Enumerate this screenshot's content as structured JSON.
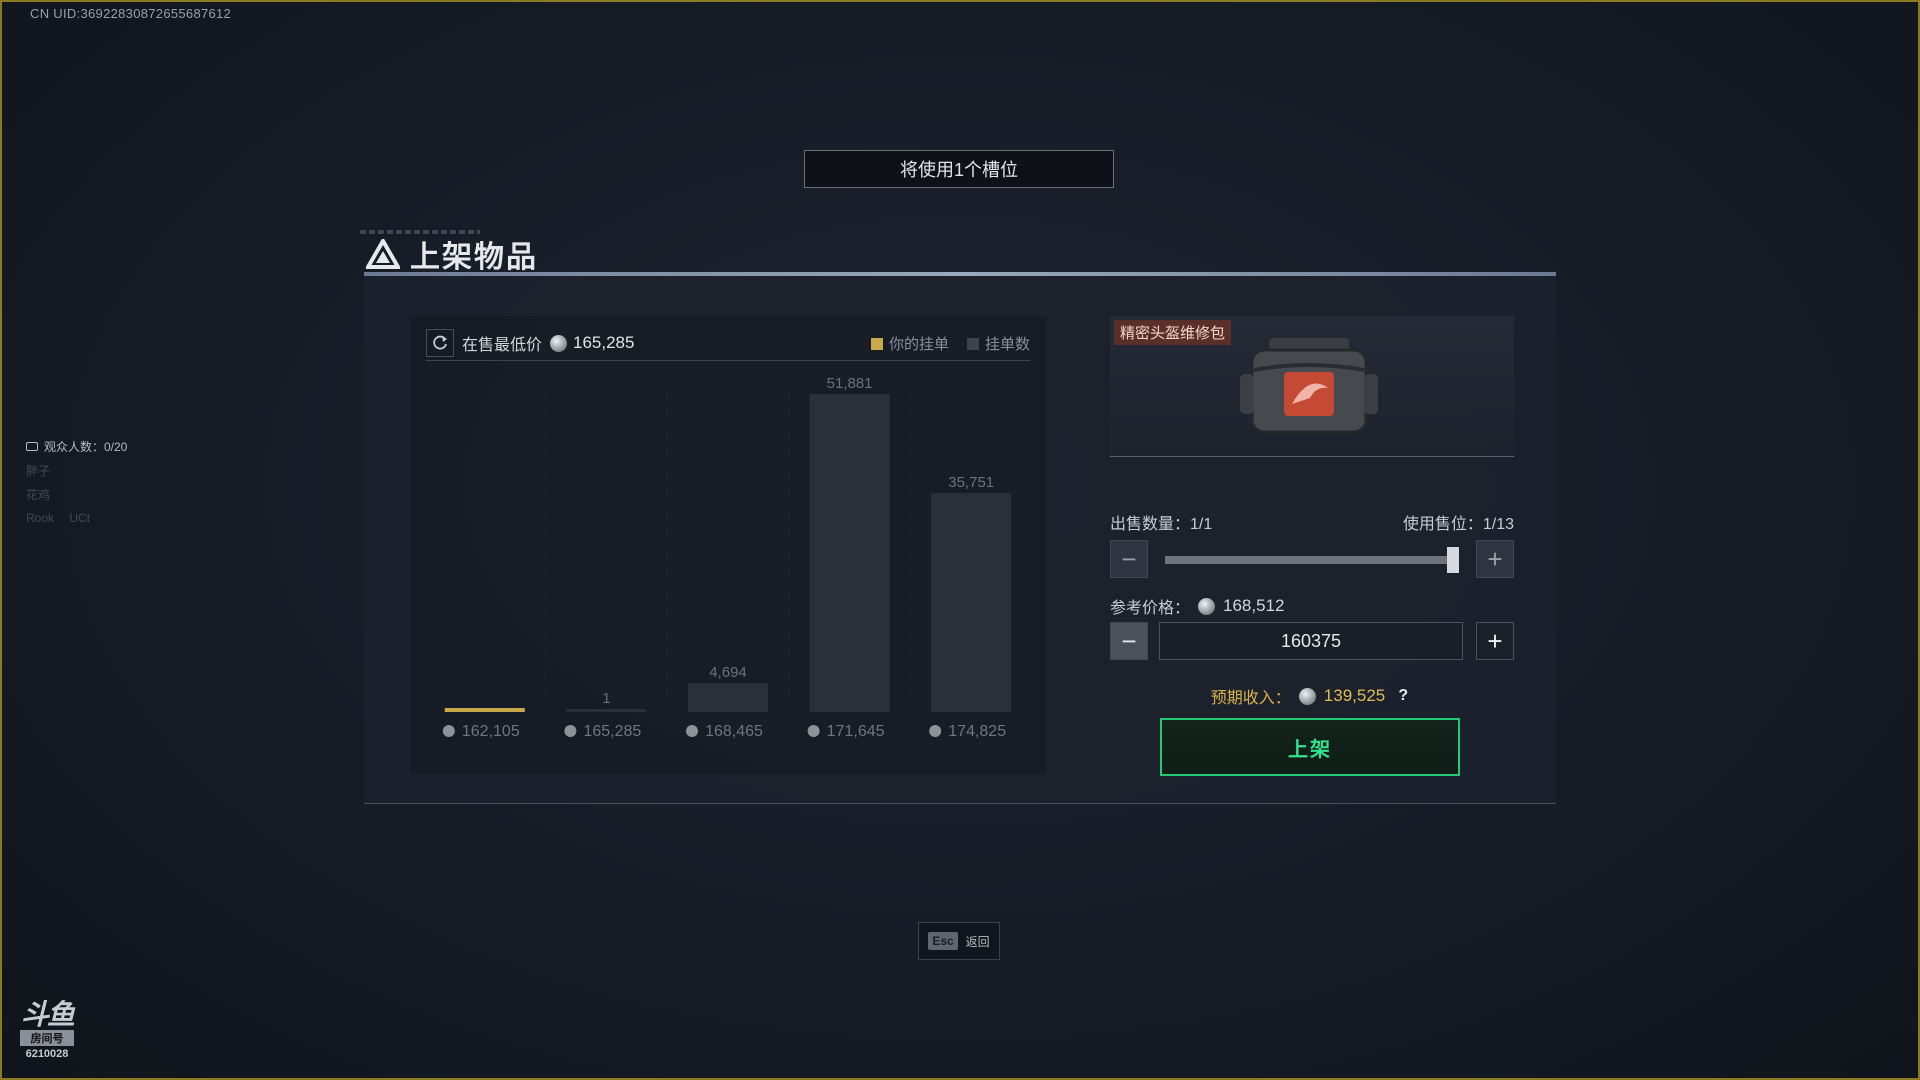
{
  "overlay": {
    "uid": "CN UID:36922830872655687612"
  },
  "slot_banner": "将使用1个槽位",
  "title": "上架物品",
  "chart_header": {
    "label": "在售最低价",
    "price": "165,285",
    "legend_yours": "你的挂单",
    "legend_count": "挂单数"
  },
  "chart_data": {
    "type": "bar",
    "categories": [
      "162,105",
      "165,285",
      "168,465",
      "171,645",
      "174,825"
    ],
    "values": [
      0,
      1,
      4694,
      51881,
      35751
    ],
    "value_labels": [
      "",
      "1",
      "4,694",
      "51,881",
      "35,751"
    ],
    "ylim": [
      0,
      51881
    ],
    "colors": {
      "bar": "#2a3039",
      "yours": "#c9a94a",
      "label": "#6b727c"
    }
  },
  "item": {
    "name": "精密头盔维修包"
  },
  "sell": {
    "qty_label": "出售数量：",
    "qty_value": "1/1",
    "slots_label": "使用售位：",
    "slots_value": "1/13",
    "qty_fraction": 1.0
  },
  "reference": {
    "label": "参考价格：",
    "value": "168,512"
  },
  "price_input": {
    "value": "160375"
  },
  "income": {
    "label": "预期收入：",
    "value": "139,525",
    "help": "?"
  },
  "list_button": "上架",
  "esc": {
    "key": "Esc",
    "label": "返回"
  },
  "sidebar": {
    "viewers": "观众人数：0/20",
    "faint_items": [
      "胖子",
      "花鸡",
      "Rook",
      "UCt"
    ]
  },
  "watermark": {
    "brand": "斗鱼",
    "tag": "房间号",
    "room": "6210028"
  },
  "colors": {
    "accent_green": "#24c978",
    "accent_gold": "#d6b24a",
    "frame": "#8a7a22"
  }
}
